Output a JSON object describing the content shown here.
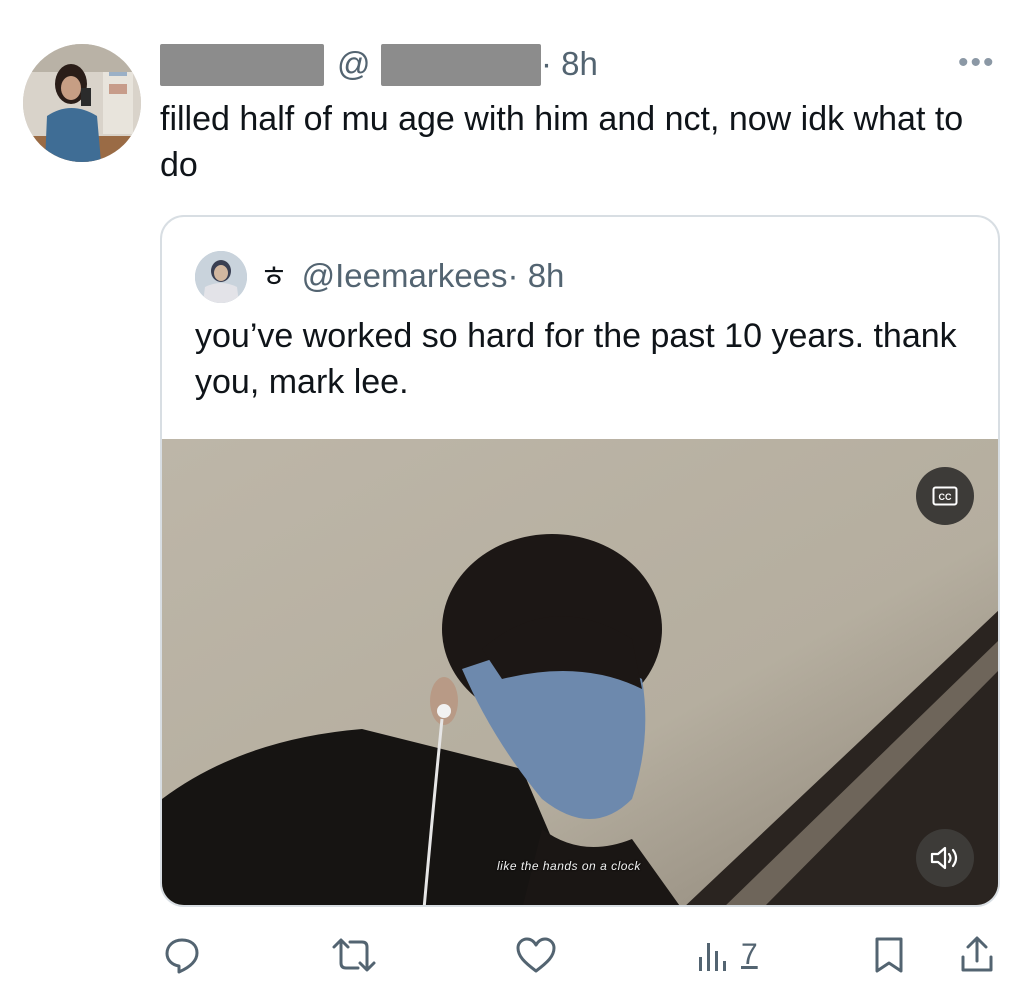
{
  "tweet": {
    "at_sign": "@",
    "time": "· 8h",
    "more_label": "•••",
    "text": "filled half of mu age with him and nct, now idk what to do"
  },
  "quoted": {
    "badge": "ㅎ",
    "handle": "@Ieemarkees",
    "time": "· 8h",
    "text": "you’ve worked so hard for the past 10 years. thank you, mark lee.",
    "video_caption": "like the hands on a clock",
    "cc_label": "CC"
  },
  "actions": {
    "views_count": "7"
  },
  "icons": {
    "reply": "reply-icon",
    "retweet": "retweet-icon",
    "like": "heart-icon",
    "views": "views-icon",
    "bookmark": "bookmark-icon",
    "share": "share-icon",
    "captions": "cc-icon",
    "volume": "volume-icon"
  },
  "colors": {
    "text": "#0f1419",
    "muted": "#536471",
    "border": "#d8dee3",
    "redaction": "#8c8c8c"
  }
}
